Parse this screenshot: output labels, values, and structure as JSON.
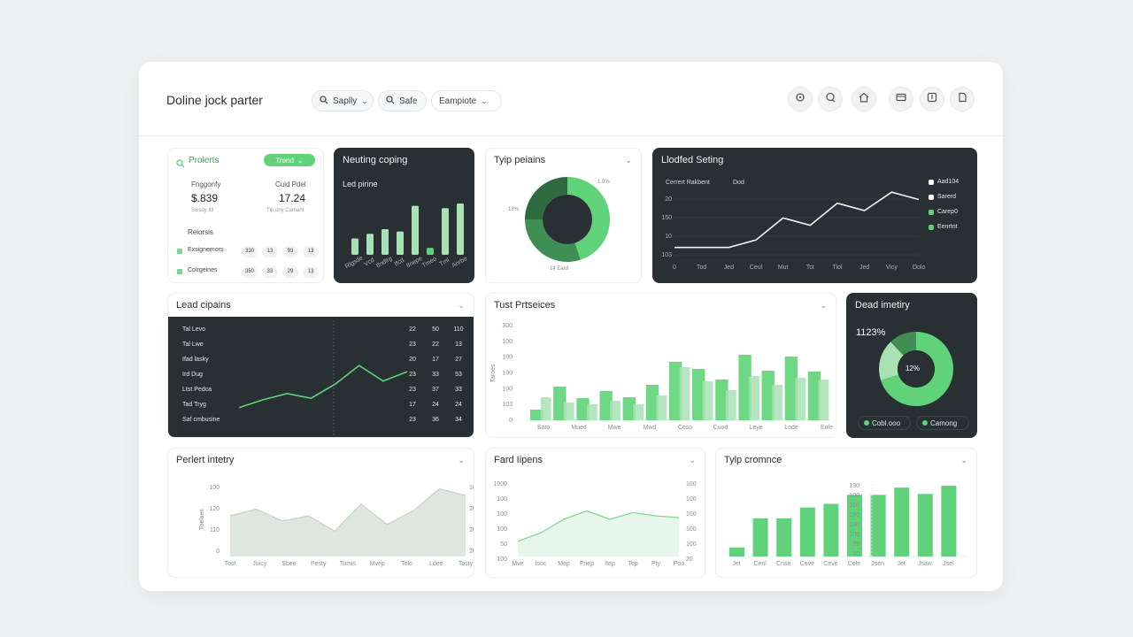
{
  "app": {
    "title": "Doline jock parter"
  },
  "toolbar": {
    "filters": [
      {
        "label": "Saplly",
        "icon": "search-icon",
        "chevron": true
      },
      {
        "label": "Safe",
        "icon": "search-icon",
        "chevron": false
      },
      {
        "label": "Eampiote",
        "icon": "",
        "chevron": true
      }
    ],
    "buttons": [
      "refresh-icon",
      "chat-icon",
      "home-icon",
      "card-icon",
      "export-icon",
      "document-icon"
    ]
  },
  "colors": {
    "accent": "#5fd27a",
    "accent_dark": "#3f8f55",
    "light_green": "#a8e2b4",
    "dark_card": "#283034"
  },
  "card_projects": {
    "title": "Prolerts",
    "badge": "Trend",
    "stat1": {
      "label": "Fnggonfy",
      "value": "$.839",
      "sub": "Swsdy Iitl"
    },
    "stat2": {
      "label": "Cuid Pdel",
      "value": "17.24",
      "sub": "Tlp.ony Camant"
    },
    "section": "Reiorsis",
    "rows": [
      {
        "label": "Exsignemors",
        "vals": [
          "330",
          "13",
          "93",
          "13"
        ]
      },
      {
        "label": "Coirgeines",
        "vals": [
          "350",
          "33",
          "29",
          "13"
        ]
      }
    ]
  },
  "card_neutral": {
    "title": "Neuting coping",
    "subtitle": "Led pirine",
    "chart_data": {
      "type": "bar",
      "values": [
        14,
        18,
        22,
        20,
        42,
        6,
        40,
        44
      ],
      "colors": [
        "light",
        "light",
        "light",
        "light",
        "light",
        "accent",
        "light",
        "light"
      ],
      "tick_labels": [
        "Rlgsde",
        "Vcd",
        "Ifndlrg",
        "Ifcd",
        "Ifnepe",
        "Tmeo",
        "Tml",
        "Anrbe"
      ]
    }
  },
  "card_typo": {
    "title": "Tyip peiains",
    "labels": {
      "left": "13%",
      "right": "1.0%",
      "bottom": "14 Eard"
    },
    "chart_data": {
      "type": "pie",
      "slices": [
        {
          "value": 45,
          "color": "#5fd27a"
        },
        {
          "value": 30,
          "color": "#3f8f55"
        },
        {
          "value": 25,
          "color": "#2f6b40"
        }
      ]
    }
  },
  "card_lodfed": {
    "title": "Llodfed Seting",
    "legend_head": "Cerrert Rakbent",
    "legend_head2": "Dod",
    "legend": [
      {
        "label": "Aad104",
        "color": "#ffffff"
      },
      {
        "label": "Sarerd",
        "color": "#ffffff"
      },
      {
        "label": "Carep0",
        "color": "#5fd27a"
      },
      {
        "label": "Eenrtnt",
        "color": "#5fd27a"
      }
    ],
    "chart_data": {
      "type": "line",
      "x": [
        "0",
        "Tod",
        "Jed",
        "Ceul",
        "Mut",
        "Tct",
        "Tiol",
        "Jed",
        "Vicy",
        "Oolo"
      ],
      "y_ticks": [
        "20",
        "150",
        "10",
        "103"
      ],
      "values": [
        2,
        2,
        2,
        4,
        10,
        8,
        14,
        12,
        17,
        15
      ]
    }
  },
  "card_lead": {
    "title": "Lead cipains",
    "rows": [
      {
        "label": "Tal Levo",
        "vals": [
          "22",
          "50",
          "110"
        ]
      },
      {
        "label": "Tal Lwe",
        "vals": [
          "23",
          "22",
          "13"
        ]
      },
      {
        "label": "Ifad lasky",
        "vals": [
          "20",
          "17",
          "27"
        ]
      },
      {
        "label": "Ird Dug",
        "vals": [
          "23",
          "33",
          "53"
        ]
      },
      {
        "label": "Ltst Pedca",
        "vals": [
          "23",
          "37",
          "33"
        ]
      },
      {
        "label": "Tad Tryg",
        "vals": [
          "17",
          "24",
          "24"
        ]
      },
      {
        "label": "Saf cmbusine",
        "vals": [
          "23",
          "36",
          "34"
        ]
      }
    ],
    "chart_data": {
      "type": "line",
      "values": [
        3,
        8,
        12,
        9,
        18,
        30,
        20,
        26
      ]
    }
  },
  "card_tust": {
    "title": "Tust Prtseices",
    "y_ticks": [
      "300",
      "100",
      "100",
      "100",
      "100",
      "103",
      "0"
    ],
    "y_label": "Taroes",
    "chart_data": {
      "type": "bar",
      "x": [
        "Sato",
        "Mued",
        "Mwe",
        "Mwd",
        "Coso",
        "Cuod",
        "Leye",
        "Lode",
        "Eule"
      ],
      "series": [
        {
          "values": [
            12,
            38,
            25,
            33,
            26,
            40,
            66,
            58,
            46,
            74,
            56,
            72,
            55
          ],
          "color": "#6fd884"
        },
        {
          "values": [
            26,
            20,
            18,
            22,
            18,
            28,
            60,
            44,
            34,
            50,
            40,
            48,
            46
          ],
          "color": "#a8e2b4"
        }
      ]
    }
  },
  "card_dead": {
    "title": "Dead imetiry",
    "value": "1123%",
    "center": "12%",
    "legend": [
      {
        "label": "Cobl.ooo"
      },
      {
        "label": "Camong"
      }
    ],
    "chart_data": {
      "type": "pie",
      "slices": [
        {
          "value": 70,
          "color": "#5fd27a"
        },
        {
          "value": 18,
          "color": "#a8e2b4"
        },
        {
          "value": 12,
          "color": "#3f8f55"
        }
      ]
    }
  },
  "card_perlert": {
    "title": "Perlert intetry",
    "y_left": [
      "100",
      "120",
      "110",
      "0"
    ],
    "y_right": [
      "100",
      "200",
      "200",
      "200"
    ],
    "y_label": "Toelaes",
    "chart_data": {
      "type": "area",
      "x": [
        "Tost",
        "Juicy",
        "Sbee",
        "Pesty",
        "Tomis",
        "Mvep",
        "Tolo",
        "Ldee",
        "Tosty"
      ],
      "values": [
        48,
        56,
        42,
        48,
        30,
        62,
        38,
        54,
        80,
        72
      ]
    }
  },
  "card_fard": {
    "title": "Fard Iipens",
    "y_left": [
      "1000",
      "100",
      "100",
      "100",
      "50",
      "100"
    ],
    "y_right": [
      "100",
      "100",
      "100",
      "100",
      "100",
      "20"
    ],
    "chart_data": {
      "type": "area",
      "x": [
        "Mve",
        "Isoc",
        "Mep",
        "Fnep",
        "Itep",
        "Tep",
        "Pty",
        "Poo"
      ],
      "values": [
        18,
        28,
        44,
        54,
        44,
        52,
        48,
        46
      ]
    }
  },
  "card_typ": {
    "title": "Tylp cromnce",
    "y_ticks": [
      "130",
      "100",
      "150",
      "190",
      "130",
      "100",
      "75",
      "10"
    ],
    "chart_data": {
      "type": "bar",
      "x": [
        "Jet",
        "Cenl",
        "Cnse",
        "Ceve",
        "Ceve",
        "Cele",
        "Jsen",
        "Jet",
        "Jsaw",
        "Jsel"
      ],
      "values": [
        10,
        42,
        42,
        54,
        58,
        68,
        68,
        76,
        69,
        78
      ]
    }
  }
}
